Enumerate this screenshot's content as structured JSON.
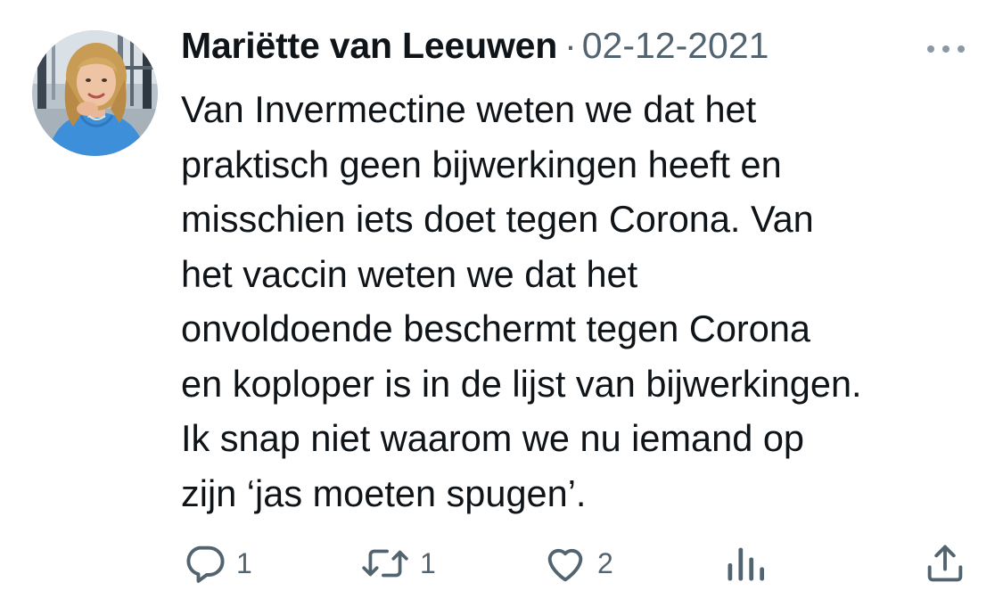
{
  "tweet": {
    "author_name": "Mariëtte van Leeuwen",
    "separator": "·",
    "date": "02-12-2021",
    "text_lines": [
      "Van Invermectine weten we dat het",
      "praktisch geen bijwerkingen heeft en",
      "misschien iets doet tegen Corona. Van",
      "het vaccin weten we dat het",
      "onvoldoende beschermt tegen Corona",
      "en koploper is in de lijst van bijwerkingen.",
      "Ik snap niet waarom we nu iemand op",
      "zijn ‘jas moeten spugen’."
    ]
  },
  "actions": {
    "reply_count": "1",
    "retweet_count": "1",
    "like_count": "2"
  },
  "icons": {
    "more": "more-horizontal-icon",
    "reply": "reply-bubble-icon",
    "retweet": "retweet-icon",
    "like": "heart-icon",
    "views": "analytics-bars-icon",
    "share": "share-upload-icon"
  },
  "colors": {
    "text_primary": "#0f1419",
    "text_secondary": "#536471",
    "background": "#ffffff"
  }
}
